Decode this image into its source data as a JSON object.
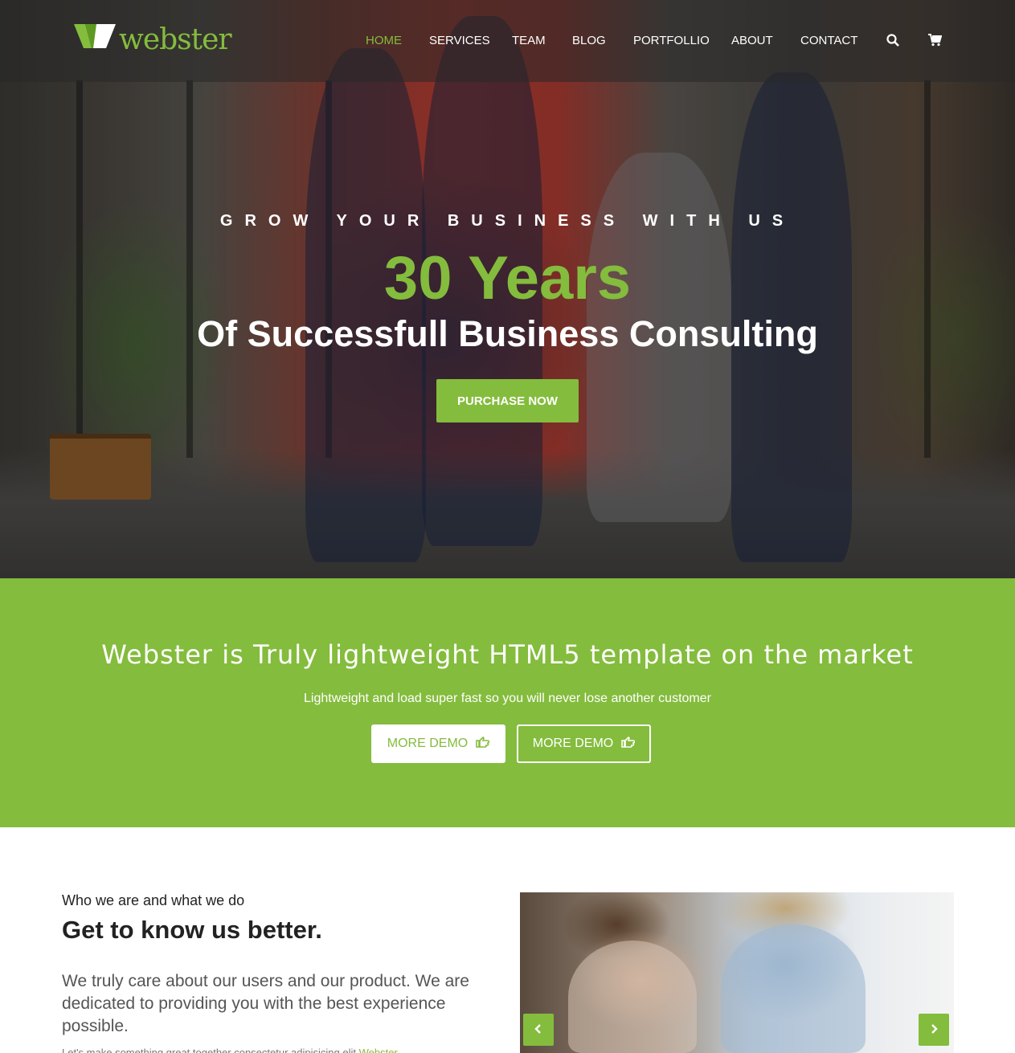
{
  "brand": {
    "name": "webster",
    "accent_color": "#84bc3d"
  },
  "nav": {
    "items": [
      {
        "label": "HOME",
        "active": true
      },
      {
        "label": "SERVICES",
        "active": false
      },
      {
        "label": "TEAM",
        "active": false
      },
      {
        "label": "BLOG",
        "active": false
      },
      {
        "label": "PORTFOLLIO",
        "active": false
      },
      {
        "label": "ABOUT",
        "active": false
      },
      {
        "label": "CONTACT",
        "active": false
      }
    ],
    "icons": [
      "search-icon",
      "cart-icon"
    ]
  },
  "hero": {
    "kicker": "GROW YOUR BUSINESS WITH US",
    "headline": "30 Years",
    "subheadline": "Of Successfull Business Consulting",
    "cta_label": "PURCHASE NOW"
  },
  "band": {
    "title": "Webster is Truly lightweight HTML5 template on the market",
    "subtitle": "Lightweight and load super fast so you will never lose another customer",
    "buttons": [
      {
        "label": "MORE DEMO",
        "icon": "hand-pointer-icon",
        "style": "light"
      },
      {
        "label": "MORE DEMO",
        "icon": "hand-pointer-icon",
        "style": "outline"
      }
    ]
  },
  "about": {
    "kicker": "Who we are and what we do",
    "title": "Get to know us better.",
    "text": "We truly care about our users and our product. We are dedicated to providing you with the best experience possible.",
    "small_text": "Let's make something great together consectetur adipisicing elit",
    "small_brand": "Webster"
  },
  "slider": {
    "prev_icon": "chevron-left-icon",
    "next_icon": "chevron-right-icon"
  }
}
